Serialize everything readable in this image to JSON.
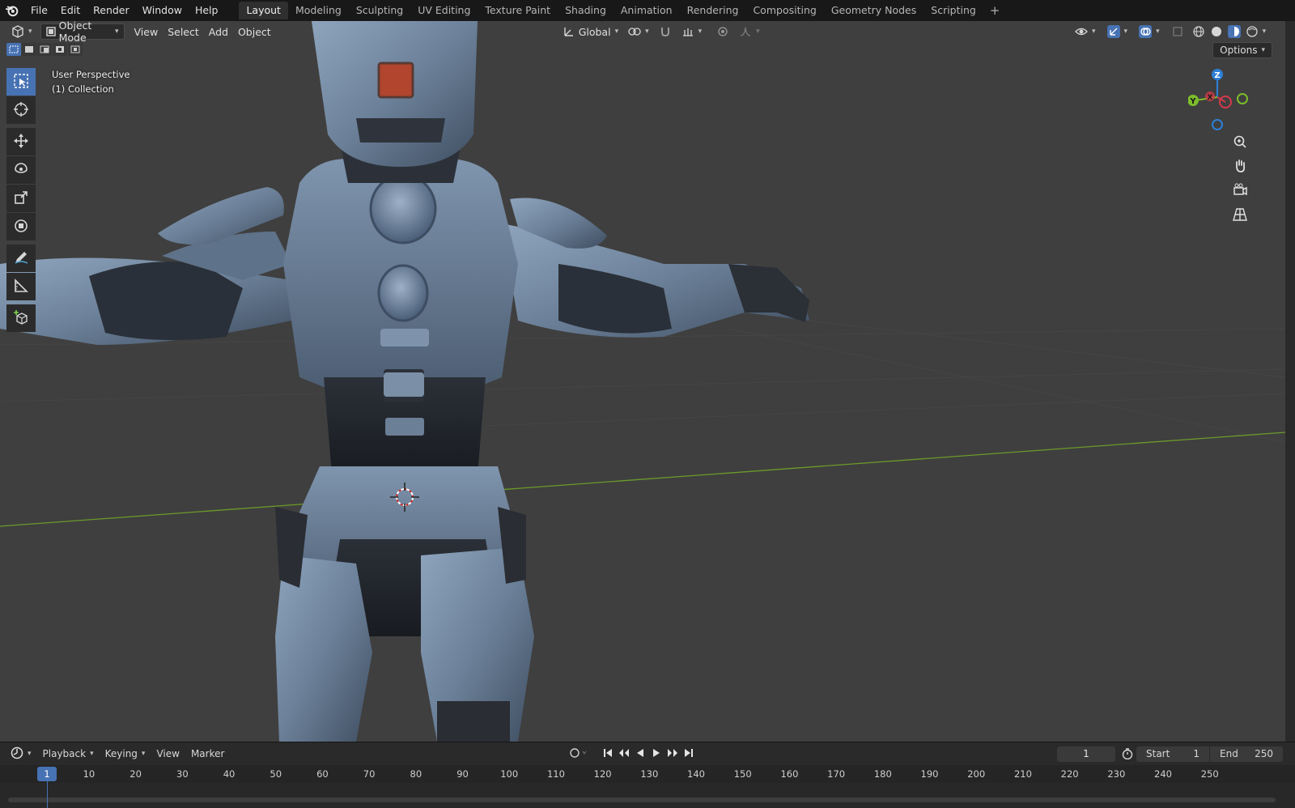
{
  "topbar": {
    "menus": [
      "File",
      "Edit",
      "Render",
      "Window",
      "Help"
    ],
    "workspaces": [
      {
        "label": "Layout",
        "active": true
      },
      {
        "label": "Modeling",
        "active": false
      },
      {
        "label": "Sculpting",
        "active": false
      },
      {
        "label": "UV Editing",
        "active": false
      },
      {
        "label": "Texture Paint",
        "active": false
      },
      {
        "label": "Shading",
        "active": false
      },
      {
        "label": "Animation",
        "active": false
      },
      {
        "label": "Rendering",
        "active": false
      },
      {
        "label": "Compositing",
        "active": false
      },
      {
        "label": "Geometry Nodes",
        "active": false
      },
      {
        "label": "Scripting",
        "active": false
      }
    ],
    "add_label": "+"
  },
  "viewport": {
    "mode": "Object Mode",
    "menus": [
      "View",
      "Select",
      "Add",
      "Object"
    ],
    "orientation": "Global",
    "options_label": "Options",
    "info_line1": "User Perspective",
    "info_line2": "(1) Collection",
    "gizmo": {
      "z": "Z",
      "y": "Y",
      "x": "X"
    }
  },
  "timeline": {
    "menus": [
      "Playback",
      "Keying",
      "View",
      "Marker"
    ],
    "current_frame": "1",
    "start_label": "Start",
    "start_value": "1",
    "end_label": "End",
    "end_value": "250",
    "ruler_labels": [
      "10",
      "20",
      "30",
      "40",
      "50",
      "60",
      "70",
      "80",
      "90",
      "100",
      "110",
      "120",
      "130",
      "140",
      "150",
      "160",
      "170",
      "180",
      "190",
      "200",
      "210",
      "220",
      "230",
      "240",
      "250"
    ],
    "ruler_cursor": "1"
  },
  "colors": {
    "accent": "#4772b3",
    "x_axis": "#d43a4a",
    "y_axis": "#7cbd2b",
    "z_axis": "#2e7fd6"
  }
}
